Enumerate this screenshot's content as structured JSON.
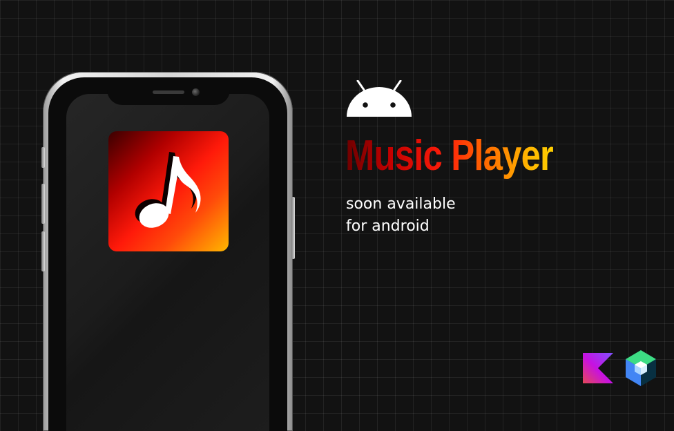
{
  "banner": {
    "title": "Music Player",
    "subtitle_line1": "soon available",
    "subtitle_line2": "for android"
  },
  "icons": {
    "platform": "android-robot-icon",
    "app": "music-note-icon",
    "language": "kotlin-icon",
    "toolkit": "jetpack-compose-icon"
  },
  "colors": {
    "background": "#121212",
    "grid_line": "#2a2a2a",
    "title_gradient_start": "#6d0000",
    "title_gradient_mid": "#ff1e0a",
    "title_gradient_end": "#ffd000",
    "android_green_replaced_white": "#ffffff",
    "kotlin_purple": "#7f52ff",
    "kotlin_pink": "#e44857",
    "compose_green": "#4285f4"
  }
}
